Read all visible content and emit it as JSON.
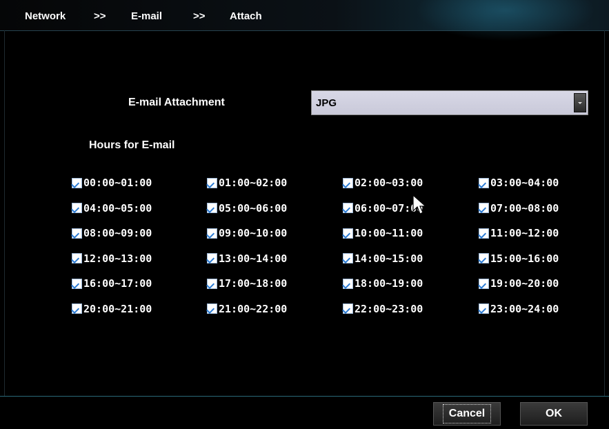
{
  "breadcrumb": {
    "items": [
      "Network",
      "E-mail",
      "Attach"
    ],
    "separator": ">>"
  },
  "attachment": {
    "label": "E-mail Attachment",
    "selected": "JPG"
  },
  "hours": {
    "heading": "Hours for E-mail",
    "slots": [
      {
        "label": "00:00~01:00",
        "checked": true
      },
      {
        "label": "01:00~02:00",
        "checked": true
      },
      {
        "label": "02:00~03:00",
        "checked": true
      },
      {
        "label": "03:00~04:00",
        "checked": true
      },
      {
        "label": "04:00~05:00",
        "checked": true
      },
      {
        "label": "05:00~06:00",
        "checked": true
      },
      {
        "label": "06:00~07:00",
        "checked": true
      },
      {
        "label": "07:00~08:00",
        "checked": true
      },
      {
        "label": "08:00~09:00",
        "checked": true
      },
      {
        "label": "09:00~10:00",
        "checked": true
      },
      {
        "label": "10:00~11:00",
        "checked": true
      },
      {
        "label": "11:00~12:00",
        "checked": true
      },
      {
        "label": "12:00~13:00",
        "checked": true
      },
      {
        "label": "13:00~14:00",
        "checked": true
      },
      {
        "label": "14:00~15:00",
        "checked": true
      },
      {
        "label": "15:00~16:00",
        "checked": true
      },
      {
        "label": "16:00~17:00",
        "checked": true
      },
      {
        "label": "17:00~18:00",
        "checked": true
      },
      {
        "label": "18:00~19:00",
        "checked": true
      },
      {
        "label": "19:00~20:00",
        "checked": true
      },
      {
        "label": "20:00~21:00",
        "checked": true
      },
      {
        "label": "21:00~22:00",
        "checked": true
      },
      {
        "label": "22:00~23:00",
        "checked": true
      },
      {
        "label": "23:00~24:00",
        "checked": true
      }
    ]
  },
  "buttons": {
    "cancel": "Cancel",
    "ok": "OK"
  },
  "colors": {
    "background": "#000000",
    "select_bg": "#d0d0e0",
    "checkbox_check": "#2a7bd4",
    "accent_line": "#2a6a7a"
  },
  "icons": {
    "dropdown": "chevron-down-icon",
    "checkbox": "checkmark-icon",
    "cursor": "mouse-pointer-icon"
  }
}
